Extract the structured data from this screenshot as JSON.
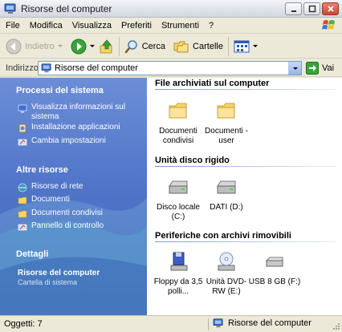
{
  "window": {
    "title": "Risorse del computer",
    "app_icon": "my-computer-icon"
  },
  "menu": {
    "items": [
      "File",
      "Modifica",
      "Visualizza",
      "Preferiti",
      "Strumenti",
      "?"
    ]
  },
  "toolbar": {
    "back_label": "Indietro",
    "search_label": "Cerca",
    "folders_label": "Cartelle"
  },
  "address": {
    "label": "Indirizzo",
    "value": "Risorse del computer",
    "go_label": "Vai"
  },
  "sidebar": {
    "system_tasks": {
      "title": "Processi del sistema",
      "links": [
        {
          "label": "Visualizza informazioni sul sistema",
          "icon": "system-info-icon"
        },
        {
          "label": "Installazione applicazioni",
          "icon": "add-remove-programs-icon"
        },
        {
          "label": "Cambia impostazioni",
          "icon": "control-panel-icon"
        }
      ]
    },
    "other_places": {
      "title": "Altre risorse",
      "links": [
        {
          "label": "Risorse di rete",
          "icon": "network-places-icon"
        },
        {
          "label": "Documenti",
          "icon": "documents-folder-icon"
        },
        {
          "label": "Documenti condivisi",
          "icon": "shared-documents-folder-icon"
        },
        {
          "label": "Pannello di controllo",
          "icon": "control-panel-icon"
        }
      ]
    },
    "details": {
      "title": "Dettagli",
      "name": "Risorse del computer",
      "subtitle": "Cartella di sistema"
    }
  },
  "content": {
    "groups": [
      {
        "title": "File archiviati sul computer",
        "items": [
          {
            "label": "Documenti condivisi",
            "icon": "folder-icon"
          },
          {
            "label": "Documenti - user",
            "icon": "folder-icon"
          }
        ]
      },
      {
        "title": "Unità disco rigido",
        "items": [
          {
            "label": "Disco locale (C:)",
            "icon": "hard-drive-icon"
          },
          {
            "label": "DATI (D:)",
            "icon": "hard-drive-icon"
          }
        ]
      },
      {
        "title": "Periferiche con archivi rimovibili",
        "items": [
          {
            "label": "Floppy da 3,5 polli...",
            "icon": "floppy-drive-icon"
          },
          {
            "label": "Unità DVD-RW (E:)",
            "icon": "dvd-drive-icon"
          },
          {
            "label": "USB 8 GB (F:)",
            "icon": "usb-drive-icon"
          }
        ]
      }
    ]
  },
  "status": {
    "objects": "Oggetti: 7",
    "location": "Risorse del computer"
  },
  "colors": {
    "sidebar_blue": "#5175C9",
    "group_line": "#7A96DF",
    "folder_yellow": "#F5D469",
    "go_green": "#3BA33B"
  }
}
